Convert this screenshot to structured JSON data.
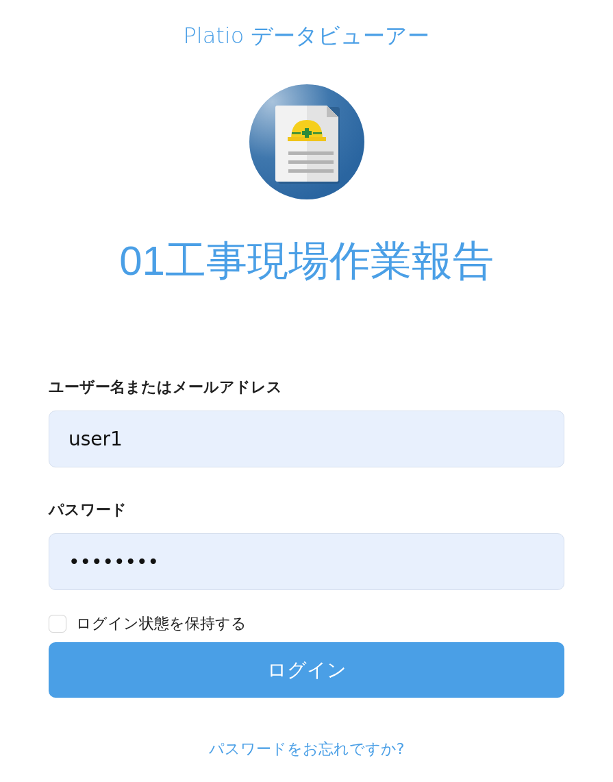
{
  "app_title": "Platio データビューアー",
  "app_name": "01工事現場作業報告",
  "fields": [
    {
      "label": "ユーザー名またはメールアドレス",
      "value": "user1"
    },
    {
      "label": "パスワード",
      "value": "••••••••"
    }
  ],
  "remember": {
    "label": "ログイン状態を保持する",
    "checked": false
  },
  "login_button": "ログイン",
  "forgot_link": "パスワードをお忘れですか?"
}
